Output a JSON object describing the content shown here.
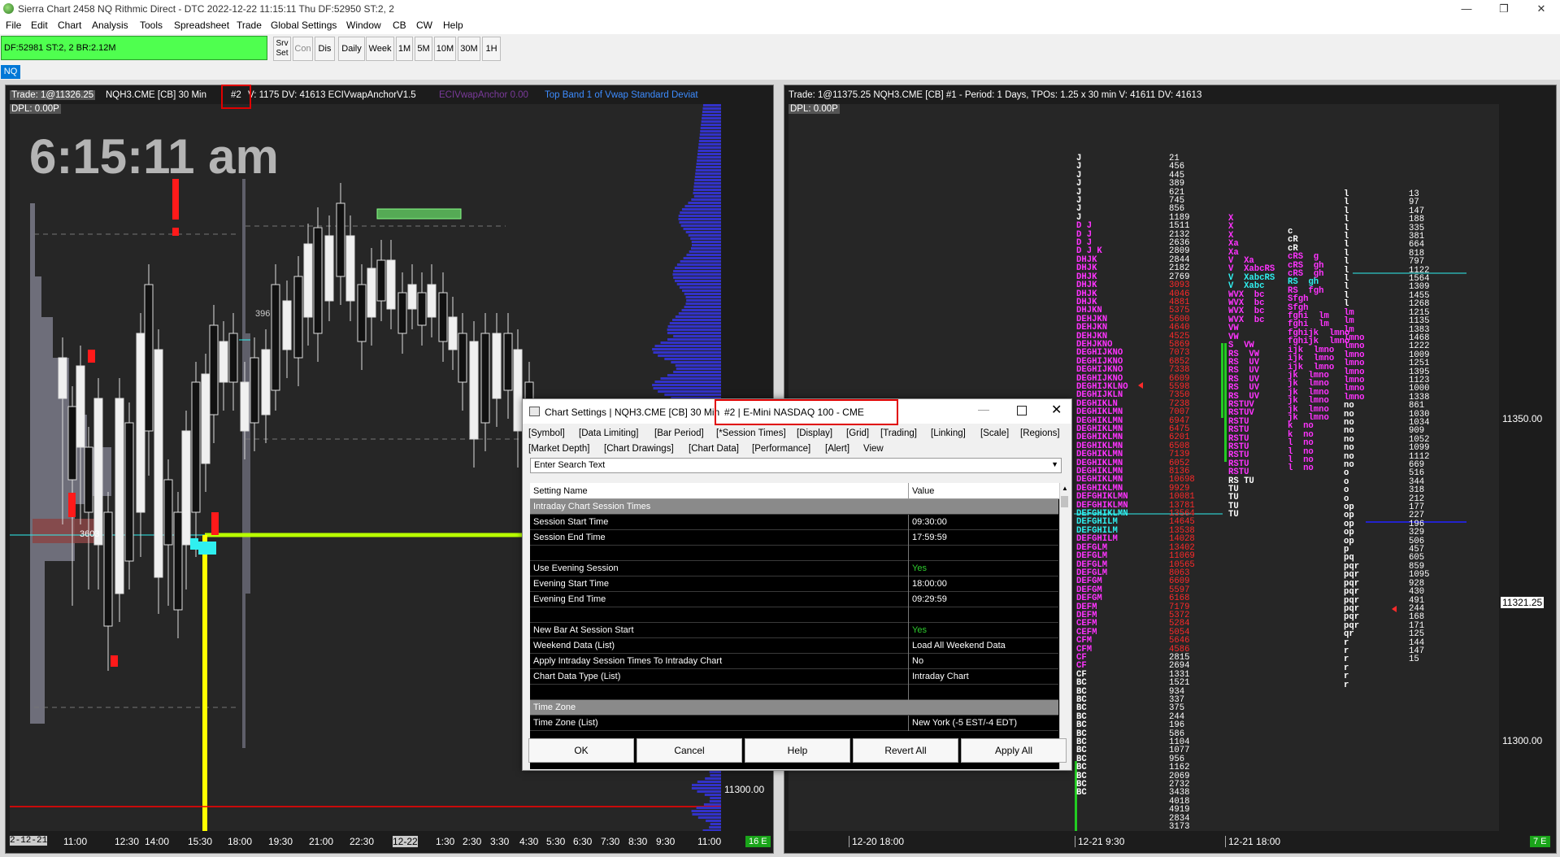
{
  "window": {
    "title": "Sierra Chart 2458 NQ  Rithmic Direct - DTC 2022-12-22  11:15:11 Thu  DF:52950  ST:2, 2",
    "controls": [
      "—",
      "❐",
      "✕"
    ]
  },
  "menu": [
    "File",
    "Edit",
    "Chart",
    "Analysis",
    "Tools",
    "Spreadsheet",
    "Trade",
    "Global Settings",
    "Window",
    "CB",
    "CW",
    "Help"
  ],
  "toolbar": {
    "status": "DF:52981  ST:2, 2  BR:2.12M",
    "srv_set": [
      "Srv",
      "Set"
    ],
    "buttons": [
      "Con",
      "Dis",
      "Daily",
      "Week",
      "1M",
      "5M",
      "10M",
      "30M",
      "1H"
    ]
  },
  "chartbook_tab": "NQ",
  "left_chart": {
    "header": "Trade: 1@11326.25  NQH3.CME [CB]  30 Min  #2  V: 1175  DV: 41613  ECIVwapAnchorV1.5",
    "header_trade": "Trade: 1@11326.25",
    "header_sym": "NQH3.CME [CB]  30 Min",
    "header_num": "#2",
    "header_vol": "V: 1175  DV: 41613  ECIVwapAnchorV1.5",
    "header_study1": "ECIVwapAnchor  0.00",
    "header_study2": "Top Band 1 of Vwap Standard Deviat",
    "dpl": "DPL: 0.00P",
    "clock": "6:15:11 am",
    "label_396": "396",
    "label_3603": "3603",
    "price_label": "11300.00",
    "time_axis": [
      "2-12-21",
      "11:00",
      "12:30",
      "14:00",
      "15:30",
      "18:00",
      "19:30",
      "21:00",
      "22:30",
      "12-22",
      "1:30",
      "2:30",
      "3:30",
      "4:30",
      "5:30",
      "6:30",
      "7:30",
      "8:30",
      "9:30",
      "11:00"
    ],
    "corner": "16 E"
  },
  "right_chart": {
    "header": "Trade: 1@11375.25  NQH3.CME [CB]  #1 - Period: 1 Days, TPOs: 1.25 x 30 min    V: 41611  DV: 41613",
    "dpl": "DPL: 0.00P",
    "price_labels": [
      "11350.00",
      "11321.25",
      "11300.00"
    ],
    "time_axis": [
      "12-20  18:00",
      "12-21  9:30",
      "12-21  18:00"
    ],
    "corner": "7 E",
    "tpo_col1": [
      "J",
      "J",
      "J",
      "J",
      "J",
      "J",
      "J",
      "J",
      "D J",
      "D J",
      "D J",
      "D J K",
      "DHJK",
      "DHJK",
      "DHJK",
      "DHJK",
      "DHJK",
      "DHJK",
      "DHJKN",
      "DEHJKN",
      "DEHJKN",
      "DEHJKN",
      "DEHJKNO",
      "DEGHIJKNO",
      "DEGHIJKNO",
      "DEGHIJKNO",
      "DEGHIJKNO",
      "DEGHIJKLNO",
      "DEGHIJKLN",
      "DEGHIKLN",
      "DEGHIKLMN",
      "DEGHIKLMN",
      "DEGHIKLMN",
      "DEGHIKLMN",
      "DEGHIKLMN",
      "DEGHIKLMN",
      "DEGHIKLMN",
      "DEGHIKLMN",
      "DEGHIKLMN",
      "DEGHIKLMN",
      "DEFGHIKLMN",
      "DEFGHIKLMN",
      "DEFGHIKLMN",
      "DEFGHILM",
      "DEFGHILM",
      "DEFGHILM",
      "DEFGLM",
      "DEFGLM",
      "DEFGLM",
      "DEFGLM",
      "DEFGM",
      "DEFGM",
      "DEFGM",
      "DEFM",
      "DEFM",
      "CEFM",
      "CEFM",
      "CFM",
      "CFM",
      "CF",
      "CF",
      "CF",
      "BC",
      "BC",
      "BC",
      "BC",
      "BC",
      "BC",
      "BC",
      "BC",
      "BC",
      "BC",
      "BC",
      "BC",
      "BC",
      "BC"
    ],
    "vol_col1": [
      "21",
      "456",
      "445",
      "389",
      "621",
      "745",
      "856",
      "1189",
      "1511",
      "2132",
      "2636",
      "2809",
      "2844",
      "2182",
      "2769",
      "3093",
      "4046",
      "4881",
      "5375",
      "5600",
      "4640",
      "4525",
      "5869",
      "7073",
      "6852",
      "7338",
      "6609",
      "5598",
      "7350",
      "7238",
      "7007",
      "6947",
      "6475",
      "6201",
      "6508",
      "7139",
      "6052",
      "8136",
      "10698",
      "9929",
      "10081",
      "13781",
      "13564",
      "14645",
      "13538",
      "14028",
      "13402",
      "11069",
      "10565",
      "8063",
      "6609",
      "5597",
      "6168",
      "7179",
      "5372",
      "5284",
      "5054",
      "5646",
      "4586",
      "2815",
      "2694",
      "1331",
      "1521",
      "934",
      "337",
      "375",
      "244",
      "196",
      "586",
      "1104",
      "1077",
      "956",
      "1162",
      "2069",
      "2732",
      "3438",
      "4018",
      "4919",
      "2834",
      "3173"
    ],
    "tpo_col2": [
      "X",
      "X",
      "X",
      "Xa",
      "Xa",
      "V  Xa",
      "V  XabcRS",
      "V  XabcRS",
      "V  Xabc",
      "WVX  bc",
      "WVX  bc",
      "WVX  bc",
      "WVX  bc",
      "VW",
      "VW",
      "S  VW",
      "RS  VW",
      "RS  UV",
      "RS  UV",
      "RS  UV",
      "RS  UV",
      "RS  UV",
      "RSTUV",
      "RSTUV",
      "RSTU",
      "RSTU",
      "RSTU",
      "RSTU",
      "RSTU",
      "RSTU",
      "RSTU",
      "RS TU",
      "TU",
      "TU",
      "TU",
      "TU"
    ],
    "tpo_col3": [
      "c",
      "cR",
      "cR",
      "cRS  g",
      "cRS  gh",
      "cRS  gh",
      "RS  gh",
      "RS  fgh",
      "Sfgh",
      "Sfgh",
      "fghi  lm",
      "fghi  lm",
      "fghijk  lmno",
      "fghijk  lmno",
      "ijk  lmno",
      "ijk  lmno",
      "ijk  lmno",
      "jk  lmno",
      "jk  lmno",
      "jk  lmno",
      "jk  lmno",
      "jk  lmno",
      "jk  lmno",
      "k  no",
      "k  no",
      "l  no",
      "l  no",
      "l  no",
      "l  no"
    ],
    "tpo_col4": [
      "l",
      "l",
      "l",
      "l",
      "l",
      "l",
      "l",
      "l",
      "l",
      "l",
      "l",
      "l",
      "l",
      "l",
      "lm",
      "lm",
      "lm",
      "lmno",
      "lmno",
      "lmno",
      "lmno",
      "lmno",
      "lmno",
      "lmno",
      "lmno",
      "no",
      "no",
      "no",
      "no",
      "no",
      "no",
      "no",
      "no",
      "o",
      "o",
      "o",
      "o",
      "op",
      "op",
      "op",
      "op",
      "op",
      "p",
      "pq",
      "pqr",
      "pqr",
      "pqr",
      "pqr",
      "pqr",
      "pqr",
      "pqr",
      "pqr",
      "qr",
      "r",
      "r",
      "r",
      "r",
      "r",
      "r"
    ],
    "vol_col4": [
      "13",
      "97",
      "147",
      "188",
      "335",
      "381",
      "664",
      "818",
      "797",
      "1122",
      "1564",
      "1309",
      "1455",
      "1268",
      "1215",
      "1135",
      "1383",
      "1468",
      "1222",
      "1009",
      "1251",
      "1395",
      "1123",
      "1000",
      "1338",
      "861",
      "1030",
      "1034",
      "909",
      "1052",
      "1099",
      "1112",
      "669",
      "516",
      "344",
      "318",
      "212",
      "177",
      "227",
      "196",
      "329",
      "506",
      "457",
      "605",
      "859",
      "1095",
      "928",
      "430",
      "491",
      "244",
      "168",
      "171",
      "125",
      "144",
      "147",
      "15"
    ]
  },
  "dialog": {
    "title": "Chart Settings | NQH3.CME [CB]  30 Min",
    "subtitle": "#2 | E-Mini NASDAQ 100 - CME",
    "tabs_row1": [
      "[Symbol]",
      "[Data Limiting]",
      "[Bar Period]",
      "[*Session Times]",
      "[Display]",
      "[Grid]",
      "[Trading]",
      "[Linking]",
      "[Scale]",
      "[Regions]"
    ],
    "tabs_row2": [
      "[Market Depth]",
      "[Chart Drawings]",
      "[Chart Data]",
      "[Performance]",
      "[Alert]",
      "View"
    ],
    "search_placeholder": "Enter Search Text",
    "col_name": "Setting Name",
    "col_value": "Value",
    "rows": [
      {
        "name": "Intraday Chart Session Times",
        "value": "",
        "section": true
      },
      {
        "name": "Session Start Time",
        "value": "09:30:00"
      },
      {
        "name": "Session End Time",
        "value": "17:59:59"
      },
      {
        "name": "",
        "value": ""
      },
      {
        "name": "Use Evening Session",
        "value": "Yes",
        "green": true
      },
      {
        "name": "Evening Start Time",
        "value": "18:00:00"
      },
      {
        "name": "Evening End Time",
        "value": "09:29:59"
      },
      {
        "name": "",
        "value": ""
      },
      {
        "name": "New Bar At Session Start",
        "value": "Yes",
        "green": true
      },
      {
        "name": "Weekend Data (List)",
        "value": "Load All Weekend Data"
      },
      {
        "name": "Apply Intraday Session Times To Intraday Chart",
        "value": "No"
      },
      {
        "name": "Chart Data Type (List)",
        "value": "Intraday Chart"
      },
      {
        "name": "",
        "value": ""
      },
      {
        "name": "Time Zone",
        "value": "",
        "section": true
      },
      {
        "name": "Time Zone (List)",
        "value": "New York (-5 EST/-4 EDT)"
      }
    ],
    "buttons": [
      "OK",
      "Cancel",
      "Help",
      "Revert All",
      "Apply All"
    ]
  },
  "colors": {
    "status_green": "#4fff4f",
    "tpo_magenta": "#ff33ff",
    "tpo_red": "#ff2a2a",
    "cyan": "#2ff0f0",
    "yellow": "#ffff00",
    "profile_blue": "#3232c8"
  }
}
